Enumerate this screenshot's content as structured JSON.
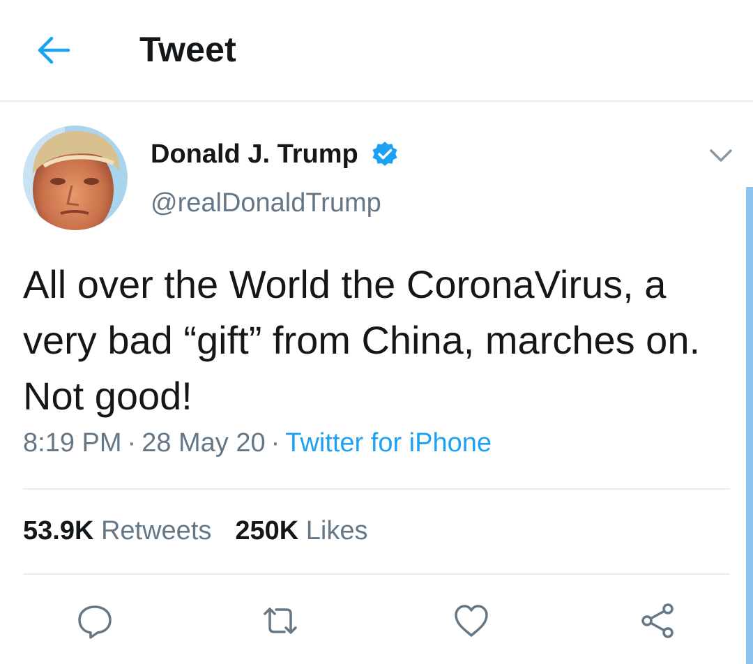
{
  "header": {
    "back_icon": "arrow-left-icon",
    "title": "Tweet"
  },
  "author": {
    "name": "Donald J. Trump",
    "handle": "@realDonaldTrump",
    "verified_icon": "verified-badge-icon",
    "menu_icon": "chevron-down-icon"
  },
  "tweet": {
    "text": "All over the World the CoronaVirus, a very bad “gift” from China, marches on. Not good!",
    "time": "8:19 PM",
    "date": "28 May 20",
    "source": "Twitter for iPhone",
    "separator": "·"
  },
  "stats": {
    "retweets_count": "53.9K",
    "retweets_label": "Retweets",
    "likes_count": "250K",
    "likes_label": "Likes"
  },
  "actions": [
    {
      "icon": "reply-icon"
    },
    {
      "icon": "retweet-icon"
    },
    {
      "icon": "heart-icon"
    },
    {
      "icon": "share-icon"
    }
  ],
  "colors": {
    "accent": "#1da1f2",
    "text_primary": "#14171a",
    "text_secondary": "#657786",
    "divider": "#e6ecf0"
  }
}
